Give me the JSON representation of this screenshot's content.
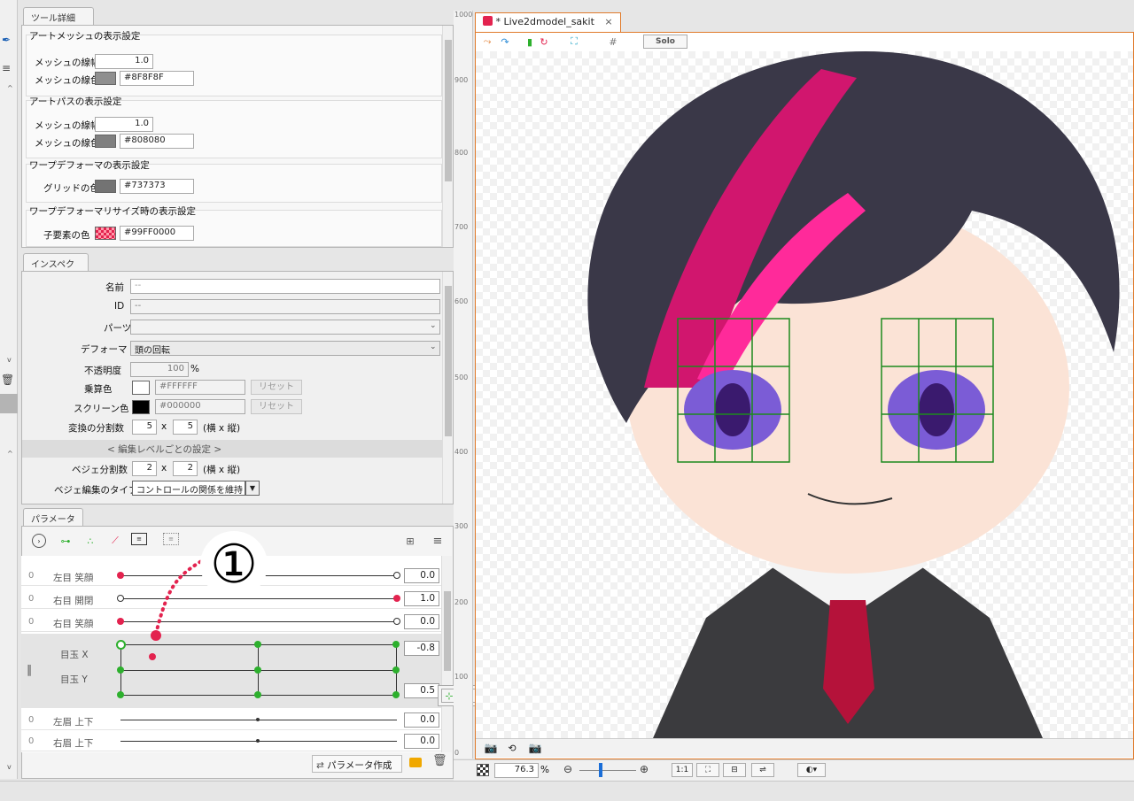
{
  "colors": {
    "accent_orange": "#e07b2c",
    "keyform_red": "#e3234f",
    "keyform_green": "#2db02d",
    "canvas_bg": "#ffffff"
  },
  "tool_detail": {
    "tab": "ツール詳細",
    "art_mesh_title": "アートメッシュの表示設定",
    "mesh_width_label": "メッシュの線幅",
    "mesh_width_value": "1.0",
    "mesh_color_label": "メッシュの線色",
    "mesh_color_value": "#8F8F8F",
    "art_path_title": "アートパスの表示設定",
    "path_width_label": "メッシュの線幅",
    "path_width_value": "1.0",
    "path_color_label": "メッシュの線色",
    "path_color_value": "#808080",
    "warp_title": "ワープデフォーマの表示設定",
    "grid_color_label": "グリッドの色",
    "grid_color_value": "#737373",
    "warp_resize_title": "ワープデフォーマリサイズ時の表示設定",
    "child_color_label": "子要素の色",
    "child_color_value": "#99FF0000"
  },
  "inspector": {
    "tab": "インスペクタ",
    "name_label": "名前",
    "name_value": "--",
    "id_label": "ID",
    "id_value": "--",
    "parts_label": "パーツ",
    "deformer_label": "デフォーマ",
    "deformer_value": "頭の回転",
    "opacity_label": "不透明度",
    "opacity_value": "100",
    "opacity_unit": "%",
    "multiply_label": "乗算色",
    "multiply_value": "#FFFFFF",
    "screen_label": "スクリーン色",
    "screen_value": "#000000",
    "reset_label": "リセット",
    "divisions_label": "変換の分割数",
    "div_x": "5",
    "div_y": "5",
    "x_sep": "x",
    "div_suffix": "(横 x 縦)",
    "edit_level_header": "< 編集レベルごとの設定 >",
    "bezier_div_label": "ベジェ分割数",
    "bezier_x": "2",
    "bezier_y": "2",
    "bezier_type_label": "ベジェ編集のタイプ",
    "bezier_type_value": "コントロールの関係を維持"
  },
  "parameters": {
    "tab": "パラメータ",
    "rows": [
      {
        "name": "左目 笑顔",
        "value": "0.0"
      },
      {
        "name": "右目 開閉",
        "value": "1.0"
      },
      {
        "name": "右目 笑顔",
        "value": "0.0"
      }
    ],
    "combined": {
      "name_x": "目玉 X",
      "name_y": "目玉 Y",
      "value_x": "-0.8",
      "value_y": "0.5"
    },
    "bottom_rows": [
      {
        "name": "左眉 上下",
        "value": "0.0"
      },
      {
        "name": "右眉 上下",
        "value": "0.0"
      }
    ],
    "create_button": "パラメータ作成",
    "annotation": "①"
  },
  "canvas": {
    "tab_title": "* Live2dmodel_sakit",
    "close": "×",
    "solo_label": "Solo",
    "ruler_marks": [
      "1000",
      "900",
      "800",
      "700",
      "600",
      "500",
      "400",
      "300",
      "200",
      "100",
      "0"
    ],
    "zoom_value": "76.3",
    "zoom_unit": "%",
    "one_to_one": "1:1"
  }
}
